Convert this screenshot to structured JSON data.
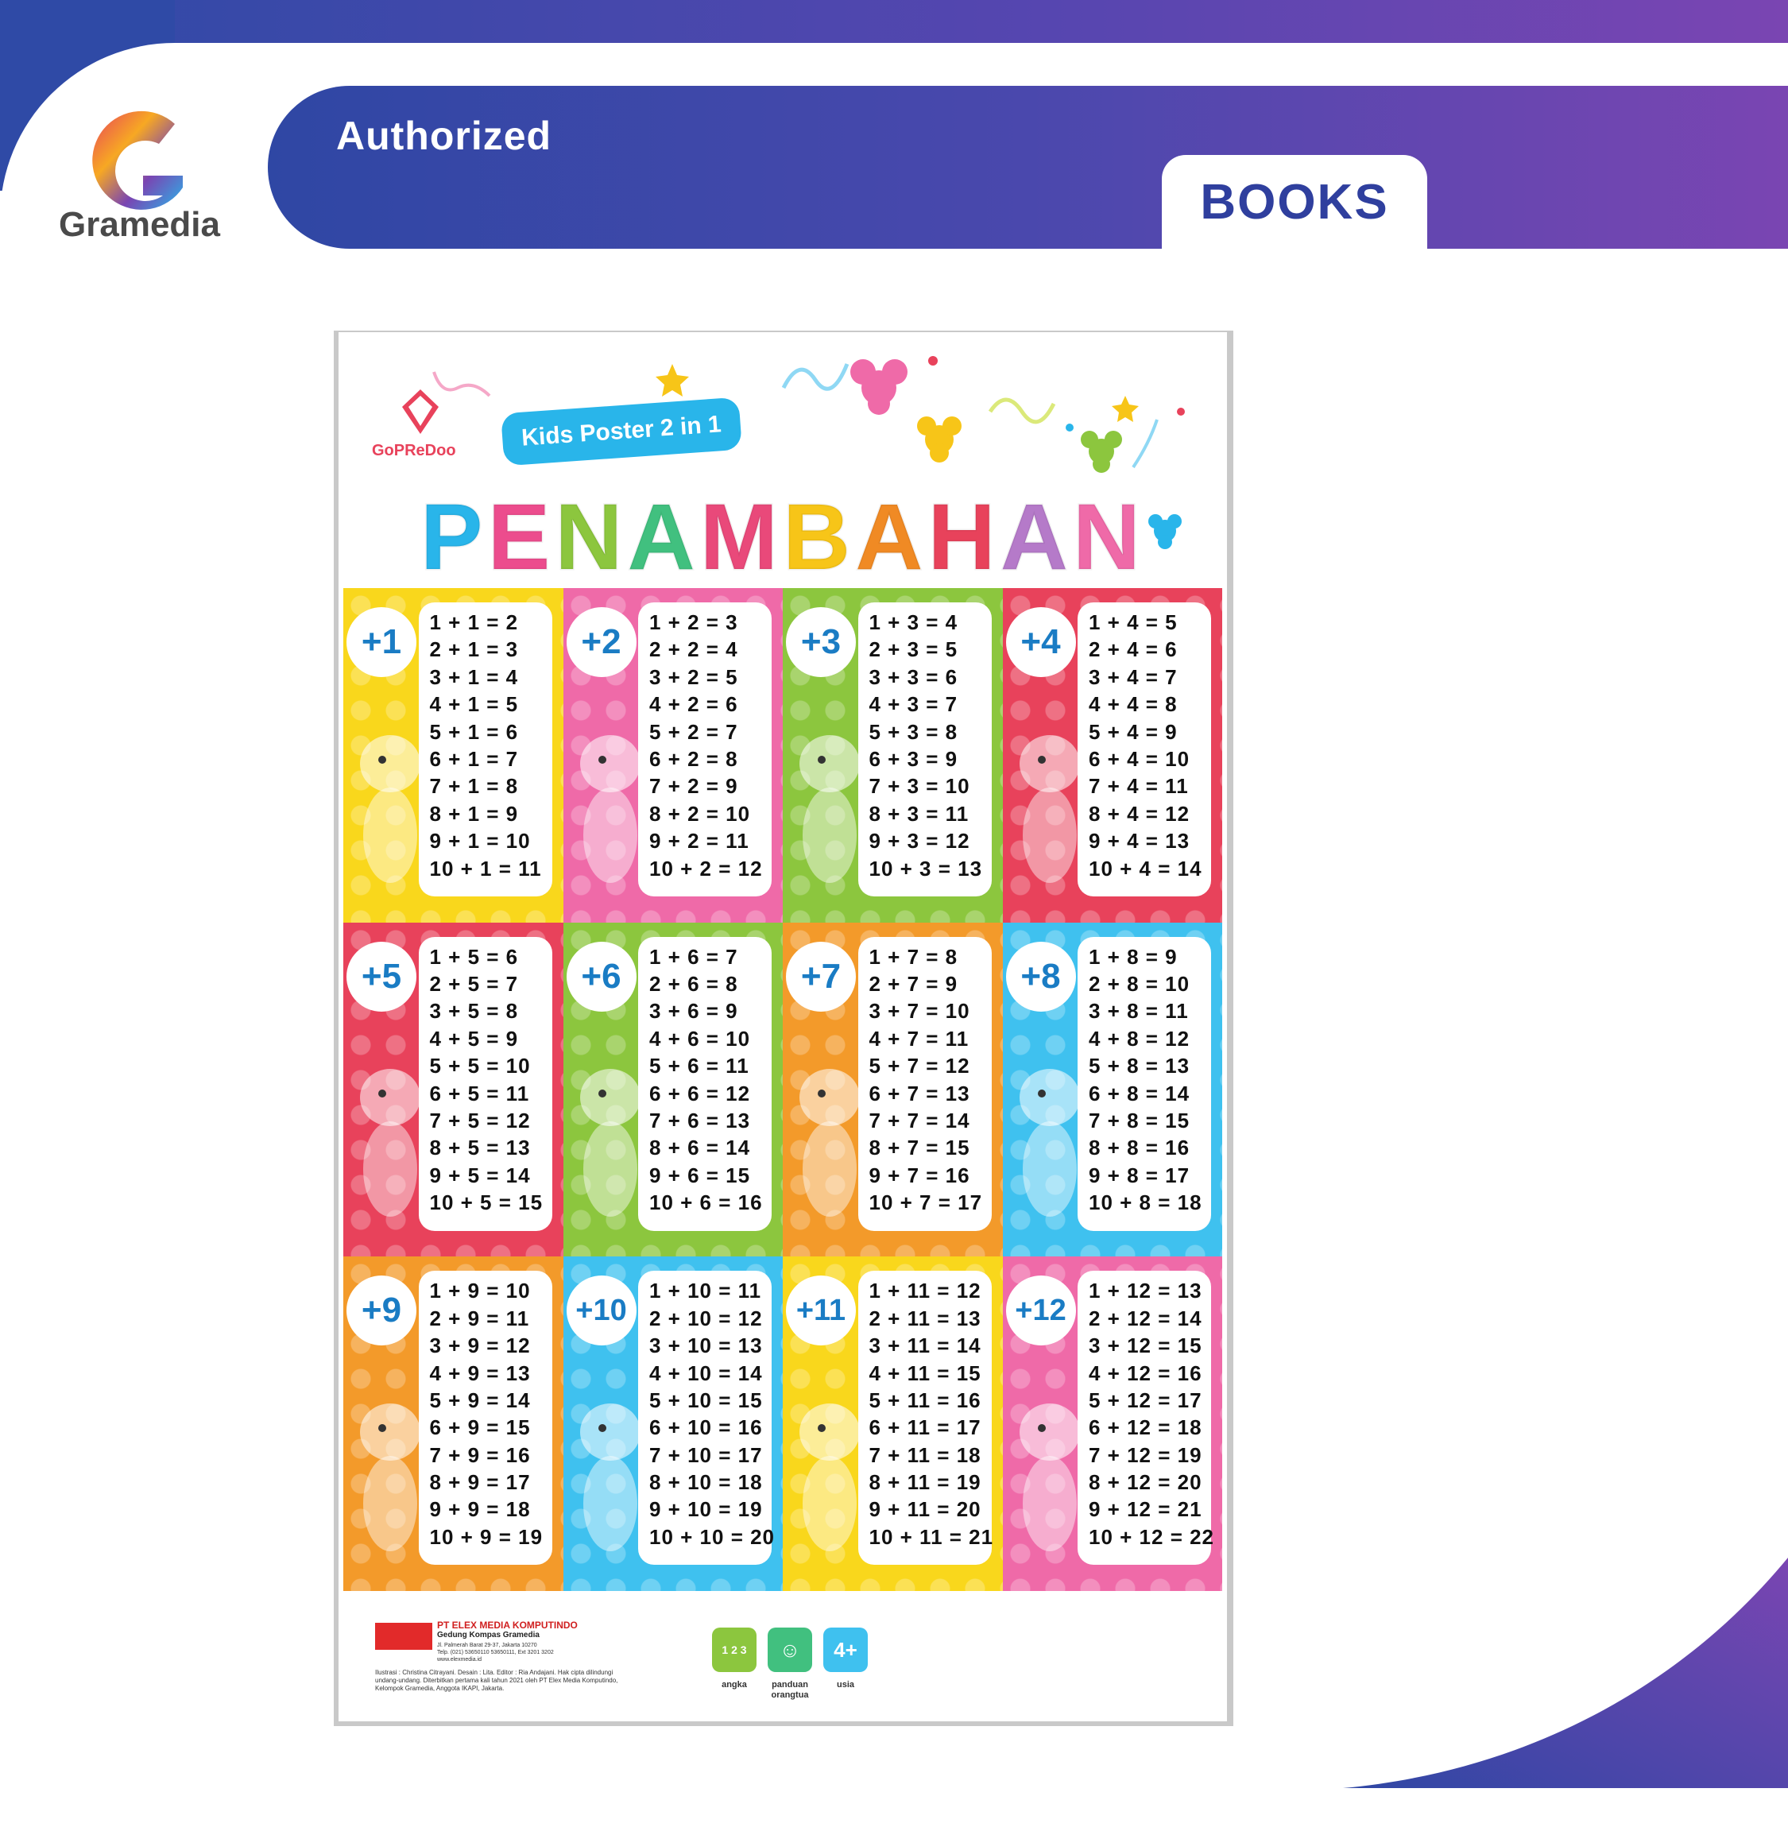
{
  "header": {
    "brand_name": "Gramedia",
    "banner_title": "Authorized",
    "tab_label": "BOOKS"
  },
  "poster": {
    "publisher_brand": "GoPReDoo",
    "series_label": "Kids Poster 2 in 1",
    "title_letters": [
      {
        "ch": "P",
        "color": "#29b5ea"
      },
      {
        "ch": "E",
        "color": "#ec4c8d"
      },
      {
        "ch": "N",
        "color": "#8cc63e"
      },
      {
        "ch": "A",
        "color": "#41c07f"
      },
      {
        "ch": "M",
        "color": "#e9497a"
      },
      {
        "ch": "B",
        "color": "#f7c518"
      },
      {
        "ch": "A",
        "color": "#f08a24"
      },
      {
        "ch": "H",
        "color": "#e8425b"
      },
      {
        "ch": "A",
        "color": "#b57ac9"
      },
      {
        "ch": "N",
        "color": "#ef6aa8"
      }
    ],
    "tables": [
      {
        "label": "+1",
        "bg": "#f9d71c",
        "animal": "deer-illustration",
        "rows": [
          "1  + 1 = 2",
          "2  + 1 = 3",
          "3  + 1 = 4",
          "4  + 1 = 5",
          "5  + 1 = 6",
          "6  + 1 = 7",
          "7  + 1 = 8",
          "8  + 1 = 9",
          "9  + 1 = 10",
          "10 + 1 = 11"
        ]
      },
      {
        "label": "+2",
        "bg": "#ef6aa8",
        "animal": "rhino-illustration",
        "rows": [
          "1  + 2 = 3",
          "2  + 2 = 4",
          "3  + 2 = 5",
          "4  + 2 = 6",
          "5  + 2 = 7",
          "6  + 2 = 8",
          "7  + 2 = 9",
          "8  + 2 = 10",
          "9  + 2 = 11",
          "10 + 2 = 12"
        ]
      },
      {
        "label": "+3",
        "bg": "#8cc63e",
        "animal": "zebra-illustration",
        "rows": [
          "1  + 3 = 4",
          "2  + 3 = 5",
          "3  + 3 = 6",
          "4  + 3 = 7",
          "5  + 3 = 8",
          "6  + 3 = 9",
          "7  + 3 = 10",
          "8  + 3 = 11",
          "9  + 3 = 12",
          "10 + 3 = 13"
        ]
      },
      {
        "label": "+4",
        "bg": "#e8425b",
        "animal": "giraffe-illustration",
        "rows": [
          "1  + 4 = 5",
          "2  + 4 = 6",
          "3  + 4 = 7",
          "4  + 4 = 8",
          "5  + 4 = 9",
          "6  + 4 = 10",
          "7  + 4 = 11",
          "8  + 4 = 12",
          "9  + 4 = 13",
          "10 + 4 = 14"
        ]
      },
      {
        "label": "+5",
        "bg": "#e8425b",
        "animal": "duck-illustration",
        "rows": [
          "1  + 5 = 6",
          "2  + 5 = 7",
          "3  + 5 = 8",
          "4  + 5 = 9",
          "5  + 5 = 10",
          "6  + 5 = 11",
          "7  + 5 = 12",
          "8  + 5 = 13",
          "9  + 5 = 14",
          "10 + 5 = 15"
        ]
      },
      {
        "label": "+6",
        "bg": "#8cc63e",
        "animal": "kangaroo-illustration",
        "rows": [
          "1  + 6 = 7",
          "2  + 6 = 8",
          "3  + 6 = 9",
          "4  + 6 = 10",
          "5  + 6 = 11",
          "6  + 6 = 12",
          "7  + 6 = 13",
          "8  + 6 = 14",
          "9  + 6 = 15",
          "10 + 6 = 16"
        ]
      },
      {
        "label": "+7",
        "bg": "#f39a2a",
        "animal": "dog-illustration",
        "rows": [
          "1  + 7 = 8",
          "2  + 7 = 9",
          "3  + 7 = 10",
          "4  + 7 = 11",
          "5  + 7 = 12",
          "6  + 7 = 13",
          "7  + 7 = 14",
          "8  + 7 = 15",
          "9  + 7 = 16",
          "10 + 7 = 17"
        ]
      },
      {
        "label": "+8",
        "bg": "#3fc1ef",
        "animal": "rooster-illustration",
        "rows": [
          "1  + 8 = 9",
          "2  + 8 = 10",
          "3  + 8 = 11",
          "4  + 8 = 12",
          "5  + 8 = 13",
          "6  + 8 = 14",
          "7  + 8 = 15",
          "8  + 8 = 16",
          "9  + 8 = 17",
          "10 + 8 = 18"
        ]
      },
      {
        "label": "+9",
        "bg": "#f39a2a",
        "animal": "cat-illustration",
        "rows": [
          "1  + 9 = 10",
          "2  + 9 = 11",
          "3  + 9 = 12",
          "4  + 9 = 13",
          "5  + 9 = 14",
          "6  + 9 = 15",
          "7  + 9 = 16",
          "8  + 9 = 17",
          "9  + 9 = 18",
          "10 + 9 = 19"
        ]
      },
      {
        "label": "+10",
        "bg": "#3fc1ef",
        "animal": "fox-illustration",
        "rows": [
          "1  + 10 = 11",
          "2  + 10 = 12",
          "3  + 10 = 13",
          "4  + 10 = 14",
          "5  + 10 = 15",
          "6  + 10 = 16",
          "7  + 10 = 17",
          "8  + 10 = 18",
          "9  + 10 = 19",
          "10 + 10 = 20"
        ]
      },
      {
        "label": "+11",
        "bg": "#f9d71c",
        "animal": "eagle-illustration",
        "rows": [
          "1  + 11 = 12",
          "2  + 11 = 13",
          "3  + 11 = 14",
          "4  + 11 = 15",
          "5  + 11 = 16",
          "6  + 11 = 17",
          "7  + 11 = 18",
          "8  + 11 = 19",
          "9  + 11 = 20",
          "10 + 11 = 21"
        ]
      },
      {
        "label": "+12",
        "bg": "#ef6aa8",
        "animal": "rabbit-illustration",
        "rows": [
          "1  + 12 = 13",
          "2  + 12 = 14",
          "3  + 12 = 15",
          "4  + 12 = 16",
          "5  + 12 = 17",
          "6  + 12 = 18",
          "7  + 12 = 19",
          "8  + 12 = 20",
          "9  + 12 = 21",
          "10 + 12 = 22"
        ]
      }
    ],
    "footer": {
      "publisher_name": "PT ELEX MEDIA KOMPUTINDO",
      "publisher_building": "Gedung Kompas Gramedia",
      "publisher_address": "Jl. Palmerah Barat 29-37, Jakarta 10270",
      "publisher_phone": "Telp. (021) 53650110 53650111, Ext 3201 3202",
      "publisher_web": "www.elexmedia.id",
      "credits": "Ilustrasi : Christina Citrayani. Desain : Lita. Editor : Ria Andajani. Hak cipta dilindungi undang-undang. Diterbitkan pertama kali tahun 2021 oleh PT Elex Media Komputindo, Kelompok Gramedia, Anggota IKAPI, Jakarta.",
      "icons": [
        {
          "glyph": "1 2 3",
          "label": "angka",
          "color": "#8cc63e"
        },
        {
          "glyph": "☺",
          "label": "panduan orangtua",
          "color": "#41c07f"
        },
        {
          "glyph": "4+",
          "label": "usia",
          "color": "#3fc1ef"
        }
      ]
    }
  }
}
